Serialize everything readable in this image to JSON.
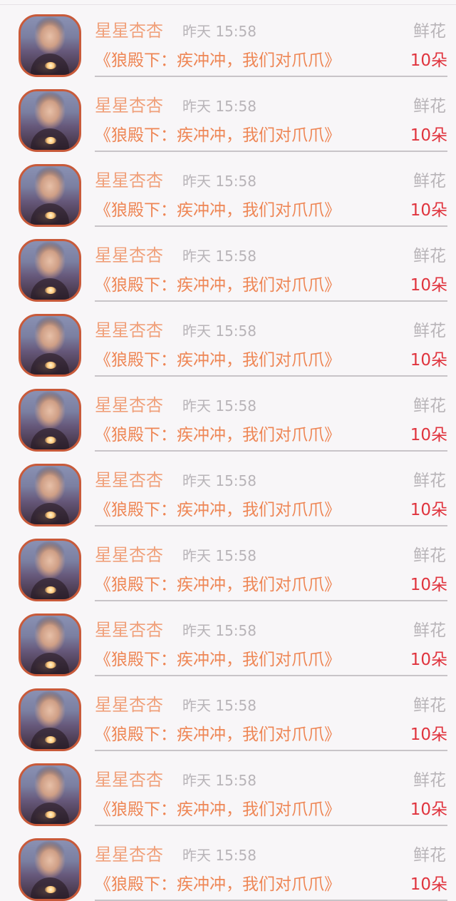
{
  "items": [
    {
      "avatar_icon": "user-avatar-photo",
      "name": "星星杏杏",
      "time": "昨天 15:58",
      "gift": "鲜花",
      "title": "《狼殿下：疾冲冲，我们对爪爪》",
      "count": "10朵"
    },
    {
      "avatar_icon": "user-avatar-photo",
      "name": "星星杏杏",
      "time": "昨天 15:58",
      "gift": "鲜花",
      "title": "《狼殿下：疾冲冲，我们对爪爪》",
      "count": "10朵"
    },
    {
      "avatar_icon": "user-avatar-photo",
      "name": "星星杏杏",
      "time": "昨天 15:58",
      "gift": "鲜花",
      "title": "《狼殿下：疾冲冲，我们对爪爪》",
      "count": "10朵"
    },
    {
      "avatar_icon": "user-avatar-photo",
      "name": "星星杏杏",
      "time": "昨天 15:58",
      "gift": "鲜花",
      "title": "《狼殿下：疾冲冲，我们对爪爪》",
      "count": "10朵"
    },
    {
      "avatar_icon": "user-avatar-photo",
      "name": "星星杏杏",
      "time": "昨天 15:58",
      "gift": "鲜花",
      "title": "《狼殿下：疾冲冲，我们对爪爪》",
      "count": "10朵"
    },
    {
      "avatar_icon": "user-avatar-photo",
      "name": "星星杏杏",
      "time": "昨天 15:58",
      "gift": "鲜花",
      "title": "《狼殿下：疾冲冲，我们对爪爪》",
      "count": "10朵"
    },
    {
      "avatar_icon": "user-avatar-photo",
      "name": "星星杏杏",
      "time": "昨天 15:58",
      "gift": "鲜花",
      "title": "《狼殿下：疾冲冲，我们对爪爪》",
      "count": "10朵"
    },
    {
      "avatar_icon": "user-avatar-photo",
      "name": "星星杏杏",
      "time": "昨天 15:58",
      "gift": "鲜花",
      "title": "《狼殿下：疾冲冲，我们对爪爪》",
      "count": "10朵"
    },
    {
      "avatar_icon": "user-avatar-photo",
      "name": "星星杏杏",
      "time": "昨天 15:58",
      "gift": "鲜花",
      "title": "《狼殿下：疾冲冲，我们对爪爪》",
      "count": "10朵"
    },
    {
      "avatar_icon": "user-avatar-photo",
      "name": "星星杏杏",
      "time": "昨天 15:58",
      "gift": "鲜花",
      "title": "《狼殿下：疾冲冲，我们对爪爪》",
      "count": "10朵"
    },
    {
      "avatar_icon": "user-avatar-photo",
      "name": "星星杏杏",
      "time": "昨天 15:58",
      "gift": "鲜花",
      "title": "《狼殿下：疾冲冲，我们对爪爪》",
      "count": "10朵"
    },
    {
      "avatar_icon": "user-avatar-photo",
      "name": "星星杏杏",
      "time": "昨天 15:58",
      "gift": "鲜花",
      "title": "《狼殿下：疾冲冲，我们对爪爪》",
      "count": "10朵"
    }
  ],
  "colors": {
    "name": "#f0a07a",
    "title": "#ee8655",
    "count": "#e0333d",
    "muted": "#b8b4b8",
    "avatar_border": "#c85a3a"
  }
}
